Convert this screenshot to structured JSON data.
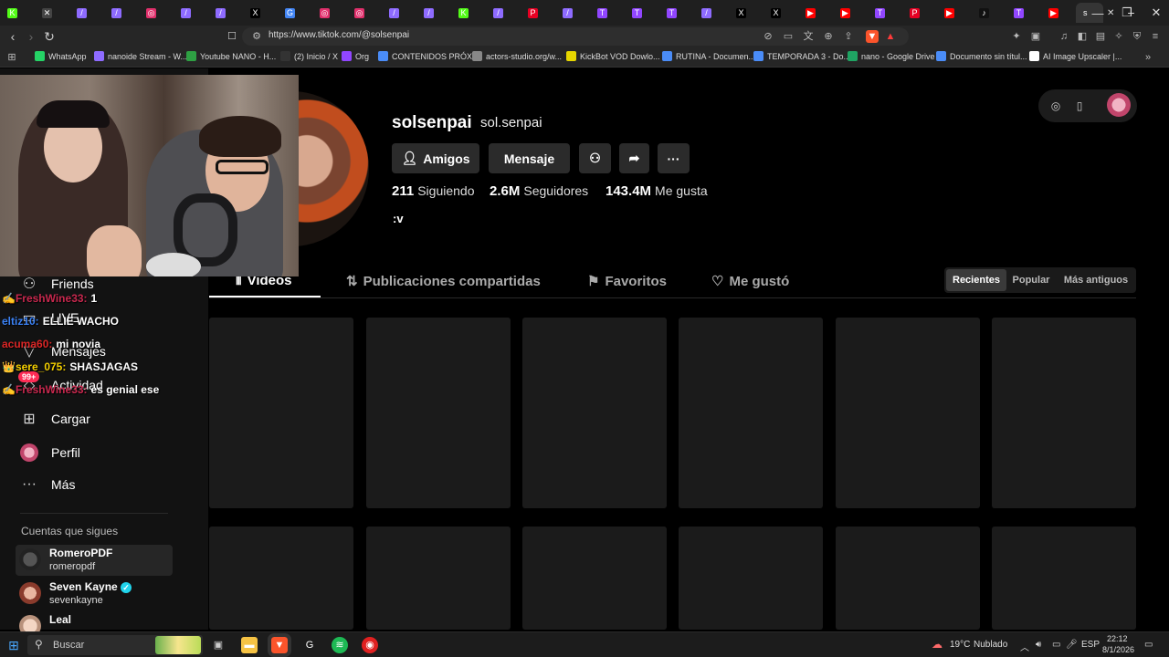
{
  "browser": {
    "tabs": [
      {
        "icon": "kick",
        "color": "#53fc18",
        "glyph": "K"
      },
      {
        "icon": "muted",
        "color": "#444",
        "glyph": "✕"
      },
      {
        "icon": "feather",
        "color": "#8e6bff",
        "glyph": "/"
      },
      {
        "icon": "feather",
        "color": "#8e6bff",
        "glyph": "/"
      },
      {
        "icon": "instagram",
        "color": "#e1306c",
        "glyph": "◎"
      },
      {
        "icon": "feather",
        "color": "#8e6bff",
        "glyph": "/"
      },
      {
        "icon": "feather",
        "color": "#8e6bff",
        "glyph": "/"
      },
      {
        "icon": "x",
        "color": "#000",
        "glyph": "X"
      },
      {
        "icon": "google",
        "color": "#4285f4",
        "glyph": "G"
      },
      {
        "icon": "instagram",
        "color": "#e1306c",
        "glyph": "◎"
      },
      {
        "icon": "instagram",
        "color": "#e1306c",
        "glyph": "◎"
      },
      {
        "icon": "feather",
        "color": "#8e6bff",
        "glyph": "/"
      },
      {
        "icon": "feather",
        "color": "#8e6bff",
        "glyph": "/"
      },
      {
        "icon": "kick",
        "color": "#53fc18",
        "glyph": "K"
      },
      {
        "icon": "feather",
        "color": "#8e6bff",
        "glyph": "/"
      },
      {
        "icon": "pinterest",
        "color": "#e60023",
        "glyph": "P"
      },
      {
        "icon": "feather",
        "color": "#8e6bff",
        "glyph": "/"
      },
      {
        "icon": "twitch",
        "color": "#9146ff",
        "glyph": "T"
      },
      {
        "icon": "twitch",
        "color": "#9146ff",
        "glyph": "T"
      },
      {
        "icon": "twitch",
        "color": "#9146ff",
        "glyph": "T"
      },
      {
        "icon": "feather",
        "color": "#8e6bff",
        "glyph": "/"
      },
      {
        "icon": "x",
        "color": "#000",
        "glyph": "X"
      },
      {
        "icon": "x",
        "color": "#000",
        "glyph": "X"
      },
      {
        "icon": "youtube",
        "color": "#ff0000",
        "glyph": "▶"
      },
      {
        "icon": "youtube",
        "color": "#ff0000",
        "glyph": "▶"
      },
      {
        "icon": "twitch",
        "color": "#9146ff",
        "glyph": "T"
      },
      {
        "icon": "pinterest",
        "color": "#e60023",
        "glyph": "P"
      },
      {
        "icon": "youtube",
        "color": "#ff0000",
        "glyph": "▶"
      },
      {
        "icon": "tiktok",
        "color": "#111",
        "glyph": "♪"
      },
      {
        "icon": "twitch",
        "color": "#9146ff",
        "glyph": "T"
      },
      {
        "icon": "youtube",
        "color": "#ff0000",
        "glyph": "▶"
      }
    ],
    "active_tab_label": "s",
    "new_tab": "+",
    "url": "https://www.tiktok.com/@solsenpai",
    "bookmarks": [
      {
        "label": "WhatsApp",
        "color": "#25d366"
      },
      {
        "label": "nanoide Stream - W...",
        "color": "#8e6bff"
      },
      {
        "label": "Youtube NANO - H...",
        "color": "#2ea043"
      },
      {
        "label": "(2) Inicio / X",
        "color": "#333"
      },
      {
        "label": "Org",
        "color": "#9146ff"
      },
      {
        "label": "CONTENIDOS PRÓX...",
        "color": "#4a8cf7"
      },
      {
        "label": "actors-studio.org/w...",
        "color": "#888"
      },
      {
        "label": "KickBot VOD Dowlo...",
        "color": "#e6d600"
      },
      {
        "label": "RUTINA - Documen...",
        "color": "#4a8cf7"
      },
      {
        "label": "TEMPORADA 3 - Do...",
        "color": "#4a8cf7"
      },
      {
        "label": "nano - Google Drive",
        "color": "#1fa463"
      },
      {
        "label": "Documento sin títul...",
        "color": "#4a8cf7"
      },
      {
        "label": "AI Image Upscaler |...",
        "color": "#fff"
      }
    ]
  },
  "profile": {
    "username": "solsenpai",
    "nickname": "sol.senpai",
    "buttons": {
      "friends": "Amigos",
      "message": "Mensaje"
    },
    "stats": [
      {
        "value": "211",
        "label": "Siguiendo"
      },
      {
        "value": "2.6M",
        "label": "Seguidores"
      },
      {
        "value": "143.4M",
        "label": "Me gusta"
      }
    ],
    "bio": ":v",
    "tabs": [
      "Videos",
      "Publicaciones compartidas",
      "Favoritos",
      "Me gustó"
    ],
    "sort": [
      "Recientes",
      "Popular",
      "Más antiguos"
    ]
  },
  "sidebar": {
    "items": [
      {
        "label": "Friends",
        "icon": "friends-icon"
      },
      {
        "label": "LIVE",
        "icon": "live-icon"
      },
      {
        "label": "Mensajes",
        "icon": "messages-icon"
      },
      {
        "label": "Actividad",
        "icon": "activity-icon",
        "badge": "99+"
      },
      {
        "label": "Cargar",
        "icon": "upload-icon"
      },
      {
        "label": "Perfil",
        "icon": "profile-icon"
      },
      {
        "label": "Más",
        "icon": "more-icon"
      }
    ],
    "following_title": "Cuentas que sigues",
    "following": [
      {
        "name": "RomeroPDF",
        "handle": "romeropdf",
        "verified": false
      },
      {
        "name": "Seven Kayne",
        "handle": "sevenkayne",
        "verified": true
      },
      {
        "name": "Leal",
        "handle": "",
        "verified": false
      }
    ]
  },
  "chat": [
    {
      "user": "FreshWine33:",
      "color": "#c8284e",
      "text": "1",
      "badge": "✍"
    },
    {
      "user": "eltiz10:",
      "color": "#3b82f6",
      "text": "ELLIE WACHO",
      "badge": ""
    },
    {
      "user": "acuma60:",
      "color": "#dc2626",
      "text": "mi novia",
      "badge": ""
    },
    {
      "user": "sere_075:",
      "color": "#f5d000",
      "text": "SHASJAGAS",
      "badge": "👑"
    },
    {
      "user": "FreshWine33:",
      "color": "#c8284e",
      "text": "es genial ese",
      "badge": "✍"
    }
  ],
  "taskbar": {
    "search": "Buscar",
    "weather": "19°C",
    "weather_text": "Nublado",
    "lang": "ESP",
    "time": "22:12",
    "date": "8/1/2026"
  }
}
